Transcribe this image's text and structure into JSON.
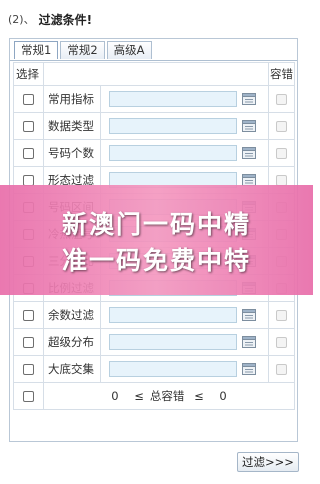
{
  "header": {
    "prefix": "(2)、",
    "title": "过滤条件!"
  },
  "tabs": [
    {
      "label": "常规1",
      "active": true
    },
    {
      "label": "常规2",
      "active": false
    },
    {
      "label": "高级A",
      "active": false
    }
  ],
  "table": {
    "col_select": "选择",
    "col_tolerance": "容错",
    "rows": [
      {
        "label": "常用指标"
      },
      {
        "label": "数据类型"
      },
      {
        "label": "号码个数"
      },
      {
        "label": "形态过滤"
      },
      {
        "label": "号码区间"
      },
      {
        "label": "冷热温号"
      },
      {
        "label": "三分区比"
      },
      {
        "label": "比例过滤"
      },
      {
        "label": "余数过滤"
      },
      {
        "label": "超级分布"
      },
      {
        "label": "大底交集"
      }
    ],
    "range": {
      "min": "0",
      "op1": "≤",
      "label": "总容错",
      "op2": "≤",
      "max": "0"
    }
  },
  "filter_button": "过滤>>>",
  "overlay": {
    "line1": "新澳门一码中精",
    "line2": "准一码免费中特"
  }
}
